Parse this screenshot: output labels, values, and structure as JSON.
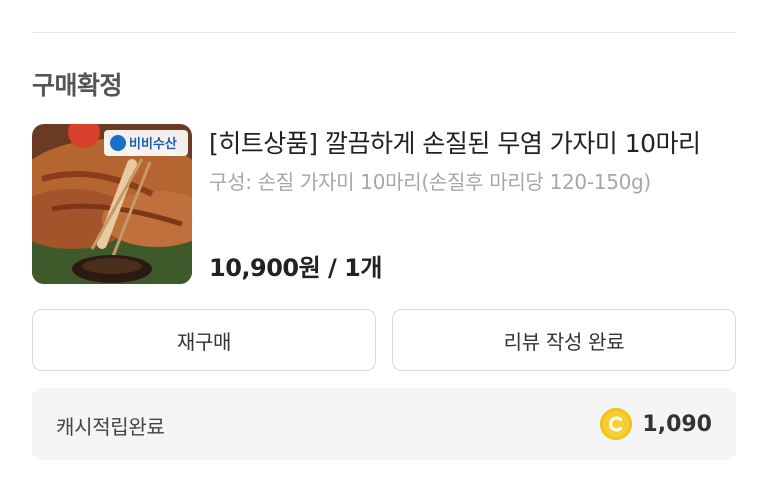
{
  "order": {
    "status_title": "구매확정",
    "product": {
      "name": "[히트상품] 깔끔하게 손질된 무염 가자미 10마리",
      "option": "구성: 손질 가자미 10마리(손질후 마리당 120-150g)",
      "price": "10,900원 / 1개",
      "image_brand_label": "비비수산"
    },
    "buttons": {
      "rebuy_label": "재구매",
      "review_label": "리뷰 작성 완료"
    },
    "cashback": {
      "label": "캐시적립완료",
      "amount": "1,090",
      "icon": "coin-icon"
    }
  },
  "colors": {
    "title_gray": "#555555",
    "option_gray": "#a7a7ab",
    "coin_yellow": "#f3c21b",
    "cash_bg": "#f5f5f7"
  }
}
